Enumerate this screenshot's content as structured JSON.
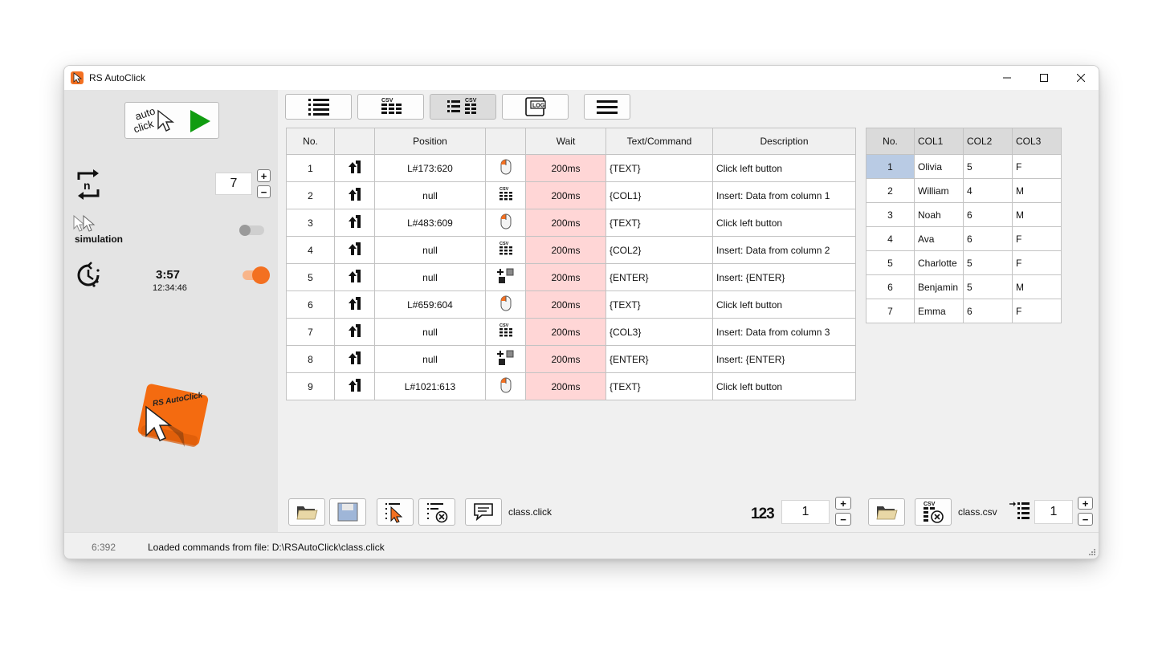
{
  "window": {
    "title": "RS AutoClick",
    "accent": "#f37021"
  },
  "sidebar": {
    "run_icon_text_1": "auto",
    "run_icon_text_2": "click",
    "loop_count": "7",
    "simulation_label": "simulation",
    "simulation_enabled": false,
    "timer_value": "3:57",
    "timer_clock": "12:34:46",
    "timer_enabled": true,
    "logo_text": "RS AutoClick"
  },
  "toolbar": {
    "csv_badge": "CSV",
    "log_badge": "LOG"
  },
  "commands": {
    "headers": [
      "No.",
      "",
      "Position",
      "",
      "Wait",
      "Text/Command",
      "Description"
    ],
    "rows": [
      {
        "no": "1",
        "position": "L#173:620",
        "type": "mouse",
        "wait": "200ms",
        "text": "{TEXT}",
        "desc": "Click left button"
      },
      {
        "no": "2",
        "position": "null",
        "type": "csv",
        "wait": "200ms",
        "text": "{COL1}",
        "desc": "Insert: Data from column 1"
      },
      {
        "no": "3",
        "position": "L#483:609",
        "type": "mouse",
        "wait": "200ms",
        "text": "{TEXT}",
        "desc": "Click left button"
      },
      {
        "no": "4",
        "position": "null",
        "type": "csv",
        "wait": "200ms",
        "text": "{COL2}",
        "desc": "Insert: Data from column 2"
      },
      {
        "no": "5",
        "position": "null",
        "type": "key",
        "wait": "200ms",
        "text": "{ENTER}",
        "desc": "Insert: {ENTER}"
      },
      {
        "no": "6",
        "position": "L#659:604",
        "type": "mouse",
        "wait": "200ms",
        "text": "{TEXT}",
        "desc": "Click left button"
      },
      {
        "no": "7",
        "position": "null",
        "type": "csv",
        "wait": "200ms",
        "text": "{COL3}",
        "desc": "Insert: Data from column 3"
      },
      {
        "no": "8",
        "position": "null",
        "type": "key",
        "wait": "200ms",
        "text": "{ENTER}",
        "desc": "Insert: {ENTER}"
      },
      {
        "no": "9",
        "position": "L#1021:613",
        "type": "mouse",
        "wait": "200ms",
        "text": "{TEXT}",
        "desc": "Click left button"
      }
    ]
  },
  "csv": {
    "headers": [
      "No.",
      "COL1",
      "COL2",
      "COL3"
    ],
    "rows": [
      [
        "1",
        "Olivia",
        "5",
        "F"
      ],
      [
        "2",
        "William",
        "4",
        "M"
      ],
      [
        "3",
        "Noah",
        "6",
        "M"
      ],
      [
        "4",
        "Ava",
        "6",
        "F"
      ],
      [
        "5",
        "Charlotte",
        "5",
        "F"
      ],
      [
        "6",
        "Benjamin",
        "5",
        "M"
      ],
      [
        "7",
        "Emma",
        "6",
        "F"
      ]
    ]
  },
  "bottom": {
    "click_file": "class.click",
    "start_line": "1",
    "csv_file": "class.csv",
    "csv_row": "1",
    "num_badge": "123"
  },
  "status": {
    "coords": "6:392",
    "message": "Loaded commands from file: D:\\RSAutoClick\\class.click"
  }
}
